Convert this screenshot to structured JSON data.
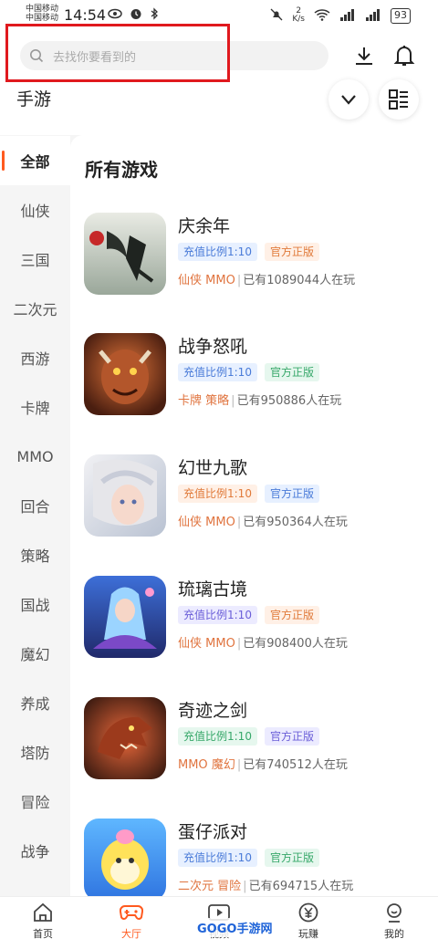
{
  "status_bar": {
    "carrier_1": "中国移动",
    "carrier_2": "中国移动",
    "time": "14:54",
    "speed_value": "2",
    "speed_unit": "K/s",
    "battery": "93"
  },
  "header": {
    "search_placeholder": "去找你要看到的",
    "title": "手游"
  },
  "sidebar": {
    "items": [
      {
        "label": "全部",
        "active": true
      },
      {
        "label": "仙侠",
        "active": false
      },
      {
        "label": "三国",
        "active": false
      },
      {
        "label": "二次元",
        "active": false
      },
      {
        "label": "西游",
        "active": false
      },
      {
        "label": "卡牌",
        "active": false
      },
      {
        "label": "MMO",
        "active": false
      },
      {
        "label": "回合",
        "active": false
      },
      {
        "label": "策略",
        "active": false
      },
      {
        "label": "国战",
        "active": false
      },
      {
        "label": "魔幻",
        "active": false
      },
      {
        "label": "养成",
        "active": false
      },
      {
        "label": "塔防",
        "active": false
      },
      {
        "label": "冒险",
        "active": false
      },
      {
        "label": "战争",
        "active": false
      }
    ]
  },
  "main": {
    "section_title": "所有游戏",
    "games": [
      {
        "name": "庆余年",
        "tag1": "充值比例1:10",
        "tag2": "官方正版",
        "cat1": "仙侠",
        "cat2": "MMO",
        "players": "已有1089044人在玩"
      },
      {
        "name": "战争怒吼",
        "tag1": "充值比例1:10",
        "tag2": "官方正版",
        "cat1": "卡牌",
        "cat2": "策略",
        "players": "已有950886人在玩"
      },
      {
        "name": "幻世九歌",
        "tag1": "充值比例1:10",
        "tag2": "官方正版",
        "cat1": "仙侠",
        "cat2": "MMO",
        "players": "已有950364人在玩"
      },
      {
        "name": "琉璃古境",
        "tag1": "充值比例1:10",
        "tag2": "官方正版",
        "cat1": "仙侠",
        "cat2": "MMO",
        "players": "已有908400人在玩"
      },
      {
        "name": "奇迹之剑",
        "tag1": "充值比例1:10",
        "tag2": "官方正版",
        "cat1": "MMO",
        "cat2": "魔幻",
        "players": "已有740512人在玩"
      },
      {
        "name": "蛋仔派对",
        "tag1": "充值比例1:10",
        "tag2": "官方正版",
        "cat1": "二次元",
        "cat2": "冒险",
        "players": "已有694715人在玩"
      }
    ]
  },
  "bottom_nav": {
    "items": [
      {
        "label": "首页"
      },
      {
        "label": "大厅"
      },
      {
        "label": "视频"
      },
      {
        "label": "玩赚"
      },
      {
        "label": "我的"
      }
    ]
  },
  "watermark": "GOGO手游网",
  "colors": {
    "accent": "#ff5a1f",
    "highlight_box": "#e0191e",
    "category_text": "#e0743f",
    "tag_blue_bg": "#e7f0ff",
    "tag_blue_fg": "#4a7bd8",
    "tag_orange_bg": "#fff0e6",
    "tag_orange_fg": "#e07a3a",
    "tag_green_bg": "#e6f7ee",
    "tag_green_fg": "#37a86a",
    "tag_purple_bg": "#ecebff",
    "tag_purple_fg": "#6b5fd8"
  }
}
